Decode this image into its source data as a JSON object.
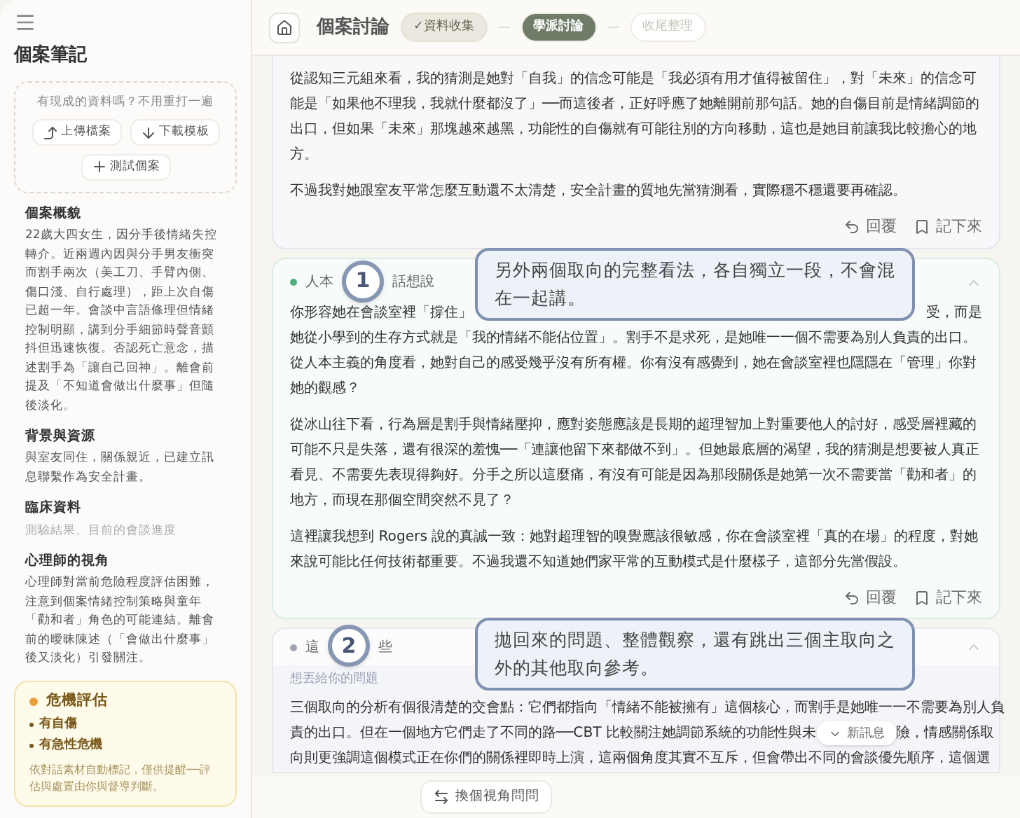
{
  "sidebar": {
    "title": "個案筆記",
    "import": {
      "prompt": "有現成的資料嗎？不用重打一遍",
      "buttons": [
        {
          "kind": "upload",
          "label": "上傳檔案"
        },
        {
          "kind": "download",
          "label": "下載模板"
        },
        {
          "kind": "sample",
          "label": "測試個案"
        }
      ]
    },
    "sections": [
      {
        "heading": "個案概貌",
        "text": "22歲大四女生，因分手後情緒失控轉介。近兩週內因與分手男友衝突而割手兩次（美工刀、手臂內側、傷口淺、自行處理），距上次自傷已超一年。會談中言語條理但情緒控制明顯，講到分手細節時聲音顫抖但迅速恢復。否認死亡意念，描述割手為「讓自己回神」。離會前提及「不知道會做出什麼事」但隨後淡化。",
        "muted": false
      },
      {
        "heading": "背景與資源",
        "text": "與室友同住，關係親近，已建立訊息聯繫作為安全計畫。",
        "muted": false
      },
      {
        "heading": "臨床資料",
        "text": "測驗結果、目前的會談進度",
        "muted": true
      },
      {
        "heading": "心理師的視角",
        "text": "心理師對當前危險程度評估困難，注意到個案情緒控制策略與童年「勸和者」角色的可能連結。離會前的曖昧陳述（「會做出什麼事」後又淡化）引發關注。",
        "muted": false
      }
    ],
    "crisis": {
      "title": "危機評估",
      "items": [
        "有自傷",
        "有急性危機"
      ],
      "note": "依對話素材自動標記，僅供提醒──評估與處置由你與督導判斷。"
    }
  },
  "header": {
    "title": "個案討論",
    "steps": [
      {
        "label": "✓資料收集",
        "done": true,
        "selected": false
      },
      {
        "label": "學派討論",
        "done": false,
        "selected": true
      },
      {
        "label": "收尾整理",
        "done": false,
        "selected": false
      }
    ]
  },
  "cards": [
    {
      "kind": "partial",
      "paragraphs": [
        "從認知三元組來看，我的猜測是她對「自我」的信念可能是「我必須有用才值得被留住」，對「未來」的信念可能是「如果他不理我，我就什麼都沒了」──而這後者，正好呼應了她離開前那句話。她的自傷目前是情緒調節的出口，但如果「未來」那塊越來越黑，功能性的自傷就有可能往別的方向移動，這也是她目前讓我比較擔心的地方。",
        "不過我對她跟室友平常怎麼互動還不太清楚，安全計畫的質地先當猜測看，實際穩不穩還要再確認。"
      ],
      "actions": [
        "回覆",
        "記下來"
      ]
    },
    {
      "kind": "annotated",
      "color": "#4caf7d",
      "title_start": "人本",
      "title_end": "話想說",
      "badge": "1",
      "note": "另外兩個取向的完整看法，各自獨立一段，不會混在一起講。",
      "covered_line": [
        "你形容她在會談室裡「撐住」",
        "受，而是"
      ],
      "paragraphs": [
        "她從小學到的生存方式就是「我的情緒不能佔位置」。割手不是求死，是她唯一一個不需要為別人負責的出口。從人本主義的角度看，她對自己的感受幾乎沒有所有權。你有沒有感覺到，她在會談室裡也隱隱在「管理」你對她的觀感？",
        "從冰山往下看，行為層是割手與情緒壓抑，應對姿態應該是長期的超理智加上對重要他人的討好，感受層裡藏的可能不只是失落，還有很深的羞愧──「連讓他留下來都做不到」。但她最底層的渴望，我的猜測是想要被人真正看見、不需要先表現得夠好。分手之所以這麼痛，有沒有可能是因為那段關係是她第一次不需要當「勸和者」的地方，而現在那個空間突然不見了？",
        "這裡讓我想到 Rogers 說的真誠一致：她對超理智的嗅覺應該很敏感，你在會談室裡「真的在場」的程度，對她來說可能比任何技術都重要。不過我還不知道她們家平常的互動模式是什麼樣子，這部分先當假設。"
      ],
      "actions": [
        "回覆",
        "記下來"
      ]
    },
    {
      "kind": "questions",
      "color": "#a0a4b8",
      "title_start": "這",
      "title_end": "些",
      "badge": "2",
      "note": "拋回來的問題、整體觀察，還有跳出三個主取向之外的其他取向參考。",
      "label": "想丟給你的問題",
      "lines": [
        "三個取向的分析有個很清楚的交會點：它們都指向「情緒不能被擁有」這個核心，而割手是她唯一一不需要為別人負",
        "責的出口。但在一個地方它們走了不同的路──CBT 比較關注她調節系統的功能性與未",
        "向則更強調這個模式正在你們的關係裡即時上演，這兩個角度其實不互斥，但會帶出不同的會談優先順序，這個選"
      ],
      "line_tail": "險，情感關係取"
    }
  ],
  "new_message": "新訊息",
  "composer": {
    "switch_label": "換個視角問問"
  }
}
